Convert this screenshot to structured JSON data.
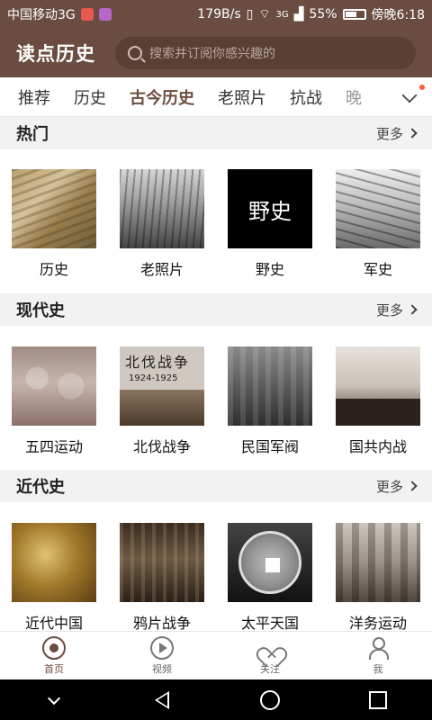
{
  "status": {
    "carrier": "中国移动3G",
    "speed": "179B/s",
    "network": "3G",
    "battery": "55%",
    "time": "傍晚6:18"
  },
  "header": {
    "title": "读点历史",
    "search_placeholder": "搜索并订阅你感兴趣的"
  },
  "tabs": [
    "推荐",
    "历史",
    "古今历史",
    "老照片",
    "抗战",
    "晚"
  ],
  "active_tab": "古今历史",
  "more_label": "更多",
  "sections": [
    {
      "title": "热门",
      "items": [
        "历史",
        "老照片",
        "野史",
        "军史"
      ]
    },
    {
      "title": "现代史",
      "items": [
        "五四运动",
        "北伐战争",
        "民国军阀",
        "国共内战"
      ]
    },
    {
      "title": "近代史",
      "items": [
        "近代中国",
        "鸦片战争",
        "太平天国",
        "洋务运动"
      ]
    }
  ],
  "thumb_text": {
    "yeshi": "野史",
    "beifa_title": "北伐战争",
    "beifa_years": "1924-1925",
    "coin": "太平天国"
  },
  "bottom_nav": [
    {
      "label": "首页",
      "icon": "home-icon",
      "active": true
    },
    {
      "label": "视频",
      "icon": "video-play-icon",
      "active": false
    },
    {
      "label": "关注",
      "icon": "heart-icon",
      "active": false
    },
    {
      "label": "我",
      "icon": "person-icon",
      "active": false
    }
  ],
  "colors": {
    "brand": "#6a4d40",
    "badge": "#ff5a3c"
  }
}
